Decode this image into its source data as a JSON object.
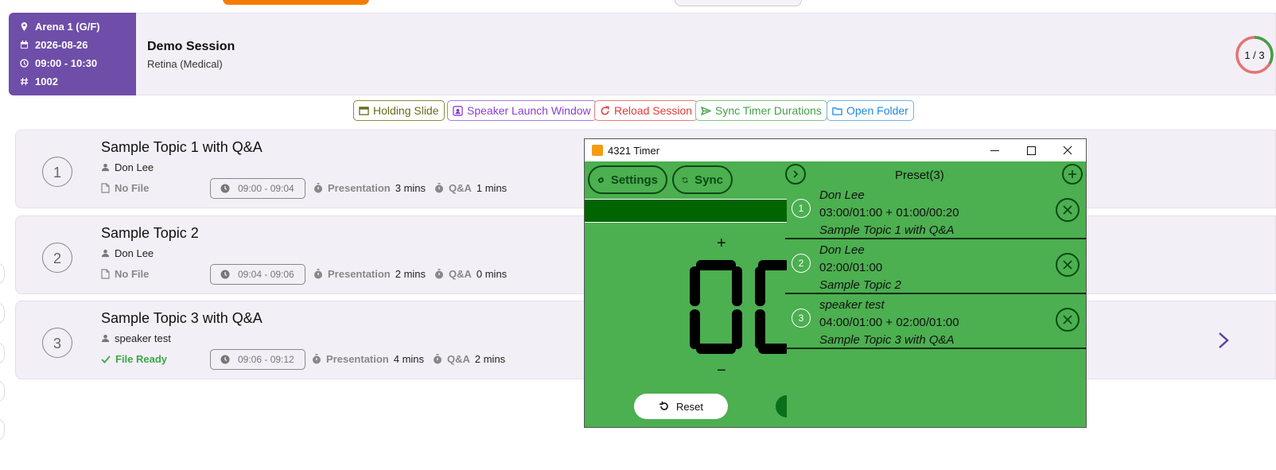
{
  "session": {
    "location": "Arena 1 (G/F)",
    "date": "2026-08-26",
    "time": "09:00 - 10:30",
    "number": "1002",
    "title": "Demo Session",
    "subtitle": "Retina (Medical)",
    "progress_text": "1 / 3",
    "progress_fraction": 0.333
  },
  "actions": [
    {
      "label": "Holding Slide",
      "color": "#6b6b1a"
    },
    {
      "label": "Speaker Launch Window",
      "color": "#8a3fd1"
    },
    {
      "label": "Reload Session",
      "color": "#e53935"
    },
    {
      "label": "Sync Timer Durations",
      "color": "#43a047"
    },
    {
      "label": "Open Folder",
      "color": "#1e88e5"
    }
  ],
  "topics": [
    {
      "num": "1",
      "title": "Sample Topic 1 with Q&A",
      "speaker": "Don Lee",
      "file": "No File",
      "file_ready": false,
      "time": "09:00 - 09:04",
      "presentation_label": "Presentation",
      "presentation": "3 mins",
      "qa_label": "Q&A",
      "qa": "1 mins"
    },
    {
      "num": "2",
      "title": "Sample Topic 2",
      "speaker": "Don Lee",
      "file": "No File",
      "file_ready": false,
      "time": "09:04 - 09:06",
      "presentation_label": "Presentation",
      "presentation": "2 mins",
      "qa_label": "Q&A",
      "qa": "0 mins"
    },
    {
      "num": "3",
      "title": "Sample Topic 3 with Q&A",
      "speaker": "speaker test",
      "file": "File Ready",
      "file_ready": true,
      "time": "09:06 - 09:12",
      "presentation_label": "Presentation",
      "presentation": "4 mins",
      "qa_label": "Q&A",
      "qa": "2 mins"
    }
  ],
  "timer": {
    "window_title": "4321 Timer",
    "settings_label": "Settings",
    "sync_label": "Sync",
    "reset_label": "Reset",
    "plus": "+",
    "minus": "−",
    "preset_title": "Preset(3)",
    "presets": [
      {
        "num": "1",
        "speaker": "Don Lee",
        "durations": "03:00/01:00 + 01:00/00:20",
        "topic": "Sample Topic 1 with Q&A"
      },
      {
        "num": "2",
        "speaker": "Don Lee",
        "durations": "02:00/01:00",
        "topic": "Sample Topic 2"
      },
      {
        "num": "3",
        "speaker": "speaker test",
        "durations": "04:00/01:00 + 02:00/01:00",
        "topic": "Sample Topic 3 with Q&A"
      }
    ]
  },
  "colors": {
    "session_meta_bg": "#6e4ea8",
    "card_bg": "#f3eff6",
    "timer_bg": "#4caf50",
    "timer_bar": "#006400",
    "file_ready": "#3aa845",
    "ring_done": "#43a047",
    "ring_remaining": "#e57373"
  },
  "icons": {
    "location": "map-pin-icon",
    "date": "calendar-icon",
    "time": "clock-icon",
    "number": "hash-icon",
    "speaker": "person-icon",
    "file": "file-icon",
    "file_ready": "check-icon",
    "stopwatch": "stopwatch-icon",
    "next": "chevron-right-icon"
  }
}
